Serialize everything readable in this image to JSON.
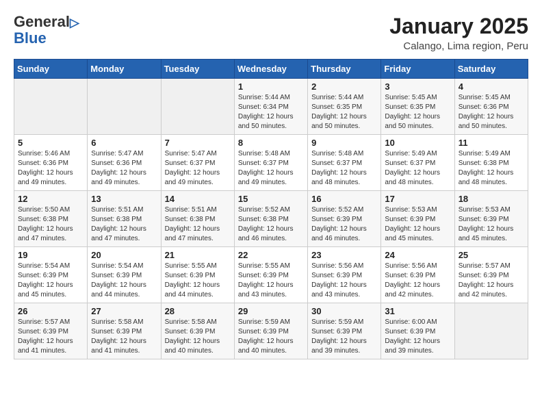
{
  "header": {
    "logo_general": "General",
    "logo_blue": "Blue",
    "title": "January 2025",
    "subtitle": "Calango, Lima region, Peru"
  },
  "weekdays": [
    "Sunday",
    "Monday",
    "Tuesday",
    "Wednesday",
    "Thursday",
    "Friday",
    "Saturday"
  ],
  "weeks": [
    [
      {
        "day": "",
        "info": ""
      },
      {
        "day": "",
        "info": ""
      },
      {
        "day": "",
        "info": ""
      },
      {
        "day": "1",
        "info": "Sunrise: 5:44 AM\nSunset: 6:34 PM\nDaylight: 12 hours\nand 50 minutes."
      },
      {
        "day": "2",
        "info": "Sunrise: 5:44 AM\nSunset: 6:35 PM\nDaylight: 12 hours\nand 50 minutes."
      },
      {
        "day": "3",
        "info": "Sunrise: 5:45 AM\nSunset: 6:35 PM\nDaylight: 12 hours\nand 50 minutes."
      },
      {
        "day": "4",
        "info": "Sunrise: 5:45 AM\nSunset: 6:36 PM\nDaylight: 12 hours\nand 50 minutes."
      }
    ],
    [
      {
        "day": "5",
        "info": "Sunrise: 5:46 AM\nSunset: 6:36 PM\nDaylight: 12 hours\nand 49 minutes."
      },
      {
        "day": "6",
        "info": "Sunrise: 5:47 AM\nSunset: 6:36 PM\nDaylight: 12 hours\nand 49 minutes."
      },
      {
        "day": "7",
        "info": "Sunrise: 5:47 AM\nSunset: 6:37 PM\nDaylight: 12 hours\nand 49 minutes."
      },
      {
        "day": "8",
        "info": "Sunrise: 5:48 AM\nSunset: 6:37 PM\nDaylight: 12 hours\nand 49 minutes."
      },
      {
        "day": "9",
        "info": "Sunrise: 5:48 AM\nSunset: 6:37 PM\nDaylight: 12 hours\nand 48 minutes."
      },
      {
        "day": "10",
        "info": "Sunrise: 5:49 AM\nSunset: 6:37 PM\nDaylight: 12 hours\nand 48 minutes."
      },
      {
        "day": "11",
        "info": "Sunrise: 5:49 AM\nSunset: 6:38 PM\nDaylight: 12 hours\nand 48 minutes."
      }
    ],
    [
      {
        "day": "12",
        "info": "Sunrise: 5:50 AM\nSunset: 6:38 PM\nDaylight: 12 hours\nand 47 minutes."
      },
      {
        "day": "13",
        "info": "Sunrise: 5:51 AM\nSunset: 6:38 PM\nDaylight: 12 hours\nand 47 minutes."
      },
      {
        "day": "14",
        "info": "Sunrise: 5:51 AM\nSunset: 6:38 PM\nDaylight: 12 hours\nand 47 minutes."
      },
      {
        "day": "15",
        "info": "Sunrise: 5:52 AM\nSunset: 6:38 PM\nDaylight: 12 hours\nand 46 minutes."
      },
      {
        "day": "16",
        "info": "Sunrise: 5:52 AM\nSunset: 6:39 PM\nDaylight: 12 hours\nand 46 minutes."
      },
      {
        "day": "17",
        "info": "Sunrise: 5:53 AM\nSunset: 6:39 PM\nDaylight: 12 hours\nand 45 minutes."
      },
      {
        "day": "18",
        "info": "Sunrise: 5:53 AM\nSunset: 6:39 PM\nDaylight: 12 hours\nand 45 minutes."
      }
    ],
    [
      {
        "day": "19",
        "info": "Sunrise: 5:54 AM\nSunset: 6:39 PM\nDaylight: 12 hours\nand 45 minutes."
      },
      {
        "day": "20",
        "info": "Sunrise: 5:54 AM\nSunset: 6:39 PM\nDaylight: 12 hours\nand 44 minutes."
      },
      {
        "day": "21",
        "info": "Sunrise: 5:55 AM\nSunset: 6:39 PM\nDaylight: 12 hours\nand 44 minutes."
      },
      {
        "day": "22",
        "info": "Sunrise: 5:55 AM\nSunset: 6:39 PM\nDaylight: 12 hours\nand 43 minutes."
      },
      {
        "day": "23",
        "info": "Sunrise: 5:56 AM\nSunset: 6:39 PM\nDaylight: 12 hours\nand 43 minutes."
      },
      {
        "day": "24",
        "info": "Sunrise: 5:56 AM\nSunset: 6:39 PM\nDaylight: 12 hours\nand 42 minutes."
      },
      {
        "day": "25",
        "info": "Sunrise: 5:57 AM\nSunset: 6:39 PM\nDaylight: 12 hours\nand 42 minutes."
      }
    ],
    [
      {
        "day": "26",
        "info": "Sunrise: 5:57 AM\nSunset: 6:39 PM\nDaylight: 12 hours\nand 41 minutes."
      },
      {
        "day": "27",
        "info": "Sunrise: 5:58 AM\nSunset: 6:39 PM\nDaylight: 12 hours\nand 41 minutes."
      },
      {
        "day": "28",
        "info": "Sunrise: 5:58 AM\nSunset: 6:39 PM\nDaylight: 12 hours\nand 40 minutes."
      },
      {
        "day": "29",
        "info": "Sunrise: 5:59 AM\nSunset: 6:39 PM\nDaylight: 12 hours\nand 40 minutes."
      },
      {
        "day": "30",
        "info": "Sunrise: 5:59 AM\nSunset: 6:39 PM\nDaylight: 12 hours\nand 39 minutes."
      },
      {
        "day": "31",
        "info": "Sunrise: 6:00 AM\nSunset: 6:39 PM\nDaylight: 12 hours\nand 39 minutes."
      },
      {
        "day": "",
        "info": ""
      }
    ]
  ]
}
